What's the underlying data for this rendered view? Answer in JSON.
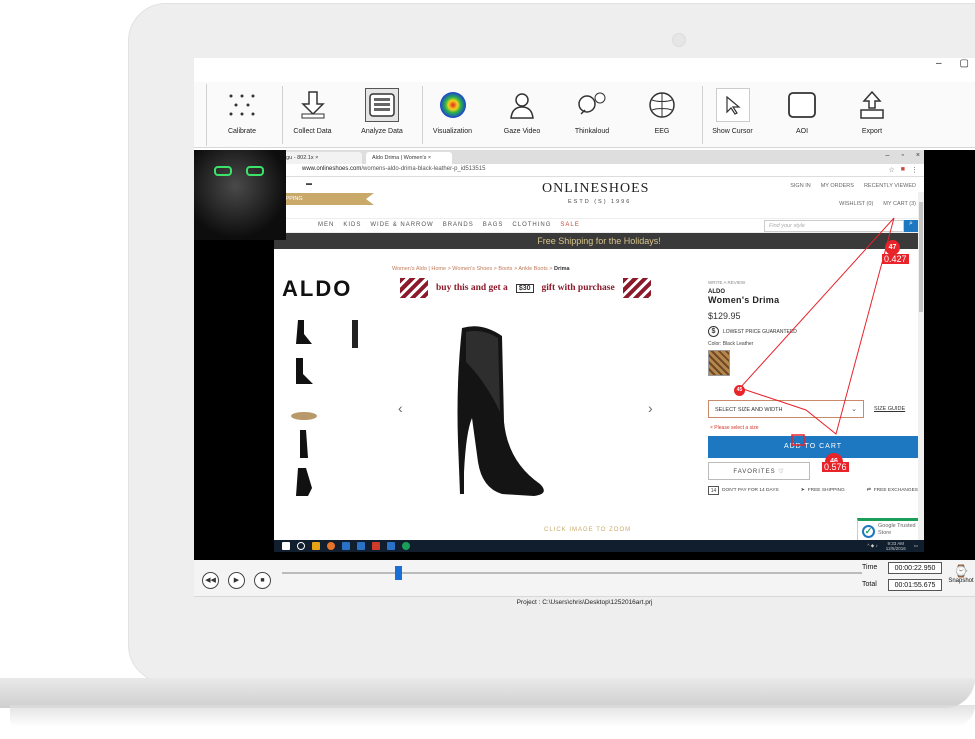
{
  "window": {
    "controls": [
      "–",
      "▢"
    ]
  },
  "ribbon": {
    "items": [
      {
        "label": "Calibrate",
        "icon": "calibrate-dots-icon"
      },
      {
        "label": "Collect Data",
        "icon": "collect-data-icon"
      },
      {
        "label": "Analyze Data",
        "icon": "analyze-data-icon",
        "active": true
      },
      {
        "label": "Visualization",
        "icon": "heatmap-icon"
      },
      {
        "label": "Gaze Video",
        "icon": "gaze-video-icon"
      },
      {
        "label": "Thinkaloud",
        "icon": "thinkaloud-icon"
      },
      {
        "label": "EEG",
        "icon": "brain-icon"
      },
      {
        "label": "Show Cursor",
        "icon": "cursor-icon"
      },
      {
        "label": "AOI",
        "icon": "aoi-icon"
      },
      {
        "label": "Export",
        "icon": "export-icon"
      }
    ]
  },
  "browser": {
    "tabs": [
      {
        "label": "negu - 802.1x ×"
      },
      {
        "label": "Aldo Drima | Women's ×"
      }
    ],
    "win_controls": [
      "–",
      "▫",
      "×"
    ],
    "url_host": "www.onlineshoes.com",
    "url_path": "/womens-aldo-drima-black-leather-p_id513515"
  },
  "site": {
    "logo": "ONLINESHOES",
    "logo_sub": "ESTD (S) 1996",
    "ship_ribbon": "IPPING",
    "topnav": [
      "SIGN IN",
      "MY ORDERS",
      "RECENTLY VIEWED"
    ],
    "topnav2": [
      "WISHLIST (0)",
      "MY CART (3)"
    ],
    "categories": [
      "MEN",
      "KIDS",
      "WIDE & NARROW",
      "BRANDS",
      "BAGS",
      "CLOTHING"
    ],
    "sale": "SALE",
    "search_placeholder": "Find your style",
    "promo": "Free Shipping for the Holidays!",
    "breadcrumb": "Women's Aldo | Home > Women's Shoes > Boots > Ankle Boots > ",
    "breadcrumb_current": "Drima",
    "brand_logo": "ALDO",
    "gift_left": "buy this and get a",
    "gift_amount": "$30",
    "gift_right": "gift with purchase",
    "zoom_hint": "CLICK IMAGE TO ZOOM"
  },
  "product": {
    "review": "WRITE A REVIEW",
    "brand": "ALDO",
    "name": "Women's Drima",
    "price": "$129.95",
    "guarantee": "LOWEST PRICE GUARANTEED",
    "color": "Color: Black Leather",
    "size_select": "SELECT SIZE AND WIDTH",
    "size_guide": "SIZE GUIDE",
    "size_error": "× Please select a size",
    "add_to_cart": "ADD TO CART",
    "favorites": "FAVORITES ♡",
    "perks": [
      "DON'T PAY FOR 14 DAYS",
      "FREE SHIPPING",
      "FREE EXCHANGES"
    ],
    "trusted": "Google Trusted Store"
  },
  "gaze": {
    "fixations": [
      {
        "id": "47",
        "value": "0.427"
      },
      {
        "id": "45",
        "value": ""
      },
      {
        "id": "46",
        "value": "0.576"
      }
    ]
  },
  "taskbar": {
    "time": "9:33 AM",
    "date": "12/5/2016"
  },
  "playback": {
    "time_label": "Time",
    "time_value": "00:00:22.950",
    "total_label": "Total",
    "total_value": "00:01:55.675",
    "progress": 0.2,
    "snapshot": "Snapshot"
  },
  "status": "Project : C:\\Users\\chris\\Desktop\\1252016art.prj",
  "colors": {
    "accent": "#1d78c1",
    "gaze": "#e8232a",
    "promo_bg": "#3a3a3a"
  }
}
